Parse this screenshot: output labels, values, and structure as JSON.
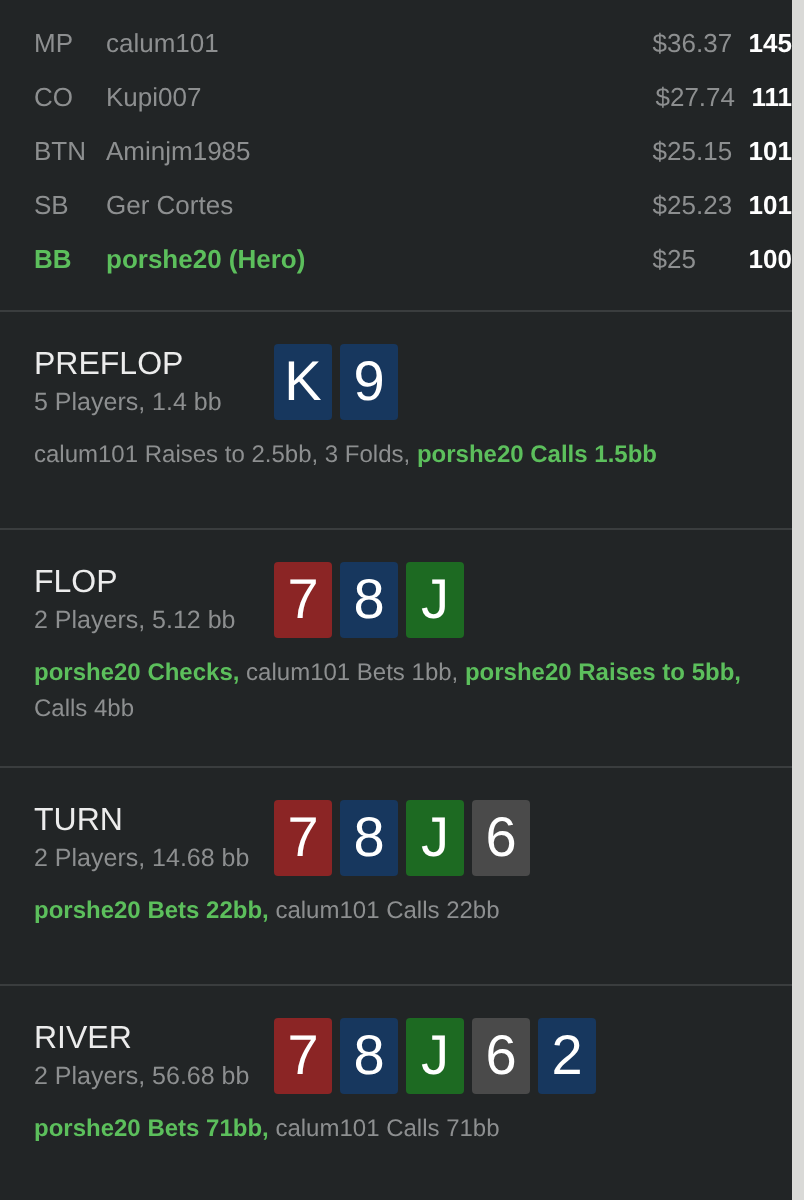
{
  "players": [
    {
      "position": "MP",
      "name": "calum101",
      "stack": "$36.37",
      "bb": "145",
      "hero": false
    },
    {
      "position": "CO",
      "name": "Kupi007",
      "stack": "$27.74",
      "bb": "111",
      "hero": false
    },
    {
      "position": "BTN",
      "name": "Aminjm1985",
      "stack": "$25.15",
      "bb": "101",
      "hero": false
    },
    {
      "position": "SB",
      "name": "Ger Cortes",
      "stack": "$25.23",
      "bb": "101",
      "hero": false
    },
    {
      "position": "BB",
      "name": "porshe20 (Hero)",
      "stack": "$25",
      "bb": "100",
      "hero": true
    }
  ],
  "streets": [
    {
      "title": "PREFLOP",
      "summary": "5 Players, 1.4 bb",
      "cards": [
        {
          "rank": "K",
          "color": "#17375e"
        },
        {
          "rank": "9",
          "color": "#17375e"
        }
      ],
      "actions": "calum101 Raises to 2.5bb, 3 Folds, **porshe20 Calls 1.5bb**"
    },
    {
      "title": "FLOP",
      "summary": "2 Players, 5.12 bb",
      "cards": [
        {
          "rank": "7",
          "color": "#8b2525"
        },
        {
          "rank": "8",
          "color": "#17375e"
        },
        {
          "rank": "J",
          "color": "#1d6a22"
        }
      ],
      "actions": "**porshe20 Checks,** calum101 Bets 1bb, **porshe20 Raises to 5bb,** Calls 4bb"
    },
    {
      "title": "TURN",
      "summary": "2 Players, 14.68 bb",
      "cards": [
        {
          "rank": "7",
          "color": "#8b2525"
        },
        {
          "rank": "8",
          "color": "#17375e"
        },
        {
          "rank": "J",
          "color": "#1d6a22"
        },
        {
          "rank": "6",
          "color": "#4a4a4a"
        }
      ],
      "actions": "**porshe20 Bets 22bb,** calum101 Calls 22bb"
    },
    {
      "title": "RIVER",
      "summary": "2 Players, 56.68 bb",
      "cards": [
        {
          "rank": "7",
          "color": "#8b2525"
        },
        {
          "rank": "8",
          "color": "#17375e"
        },
        {
          "rank": "J",
          "color": "#1d6a22"
        },
        {
          "rank": "6",
          "color": "#4a4a4a"
        },
        {
          "rank": "2",
          "color": "#17375e"
        }
      ],
      "actions": "**porshe20 Bets 71bb,** calum101 Calls 71bb"
    }
  ]
}
